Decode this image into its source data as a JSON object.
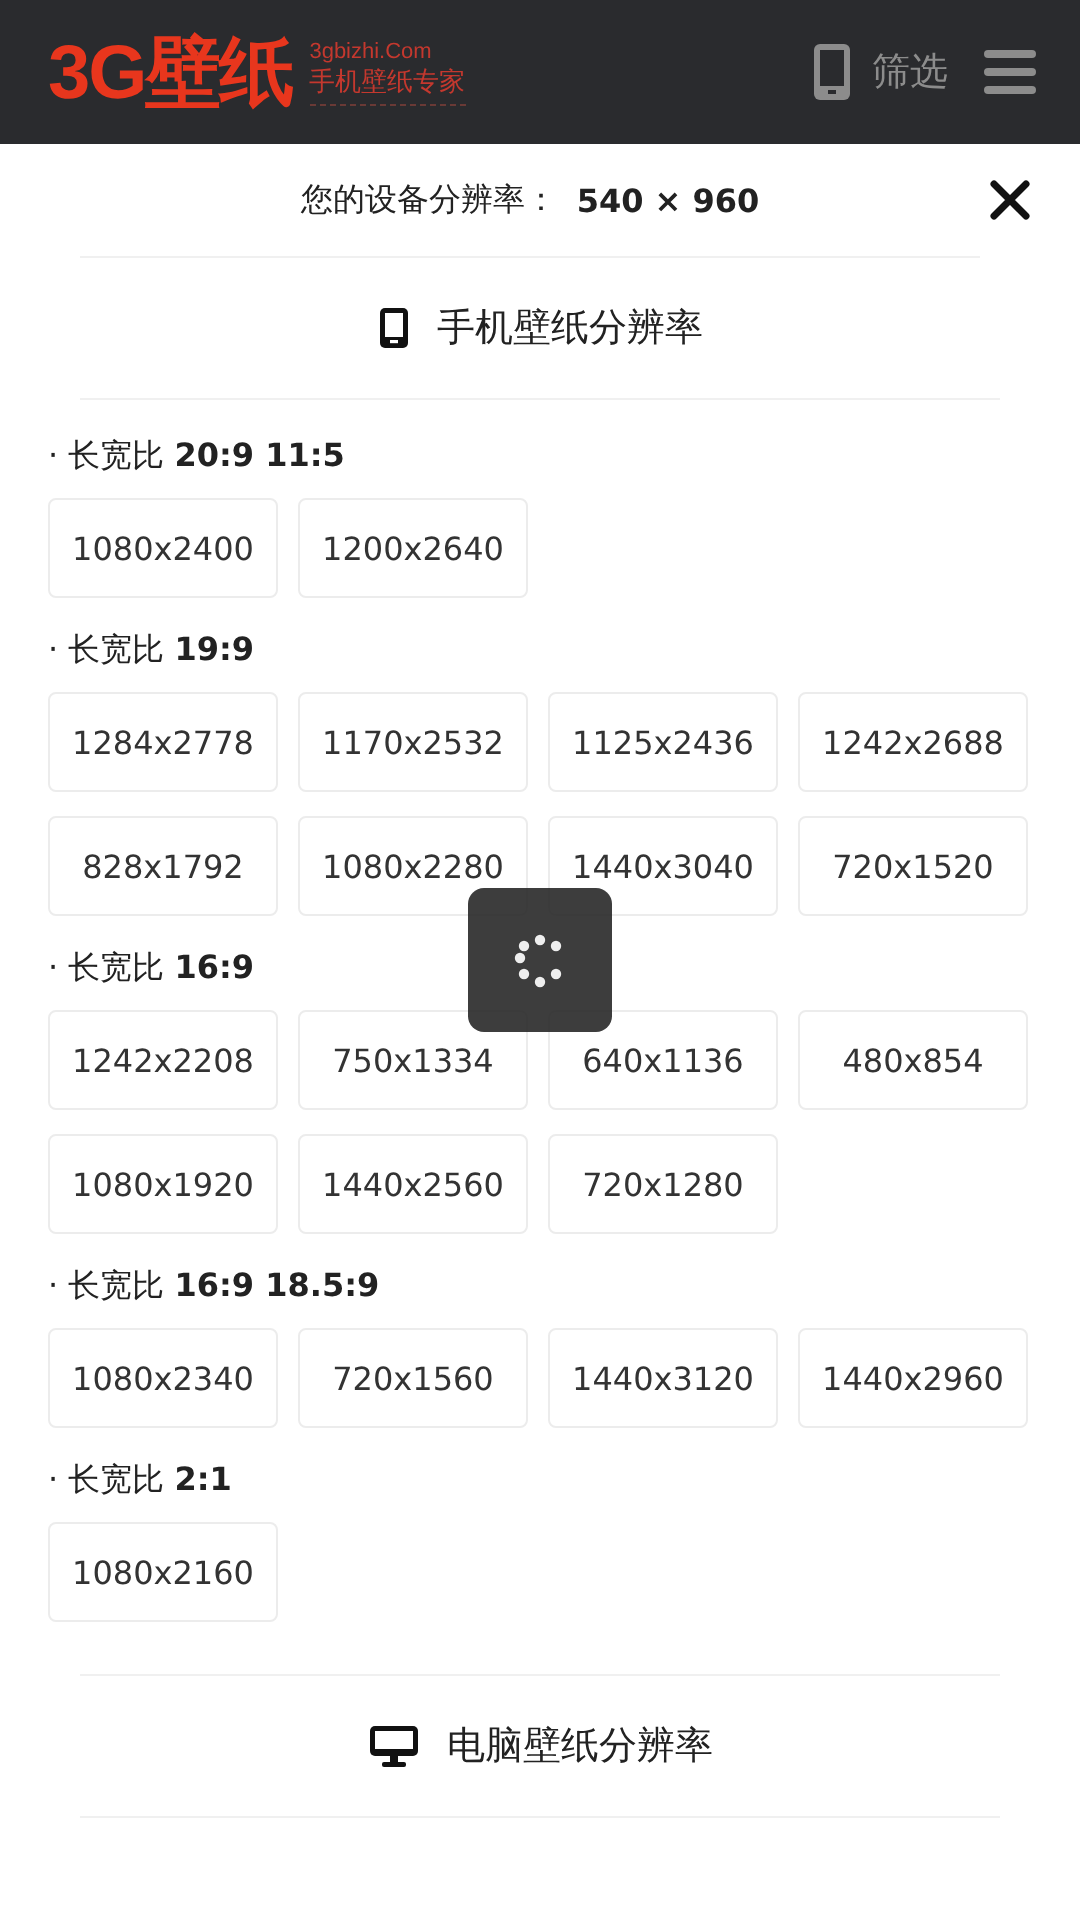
{
  "header": {
    "logo": "3G壁纸",
    "domain": "3gbizhi.Com",
    "slogan": "手机壁纸专家",
    "filter": "筛选"
  },
  "device": {
    "label": "您的设备分辨率：",
    "value": "540 × 960"
  },
  "sections": [
    {
      "kind": "phone",
      "title": "手机壁纸分辨率",
      "groups": [
        {
          "label": "· 长宽比 **20:9 11:5**",
          "sizes": [
            "1080x2400",
            "1200x2640"
          ]
        },
        {
          "label": "· 长宽比 **19:9**",
          "sizes": [
            "1284x2778",
            "1170x2532",
            "1125x2436",
            "1242x2688",
            "828x1792",
            "1080x2280",
            "1440x3040",
            "720x1520"
          ]
        },
        {
          "label": "· 长宽比 **16:9**",
          "sizes": [
            "1242x2208",
            "750x1334",
            "640x1136",
            "480x854",
            "1080x1920",
            "1440x2560",
            "720x1280"
          ]
        },
        {
          "label": "· 长宽比 **16:9 18.5:9**",
          "sizes": [
            "1080x2340",
            "720x1560",
            "1440x3120",
            "1440x2960"
          ]
        },
        {
          "label": "· 长宽比 **2:1**",
          "sizes": [
            "1080x2160"
          ]
        }
      ]
    },
    {
      "kind": "desktop",
      "title": "电脑壁纸分辨率"
    }
  ],
  "loading": true
}
